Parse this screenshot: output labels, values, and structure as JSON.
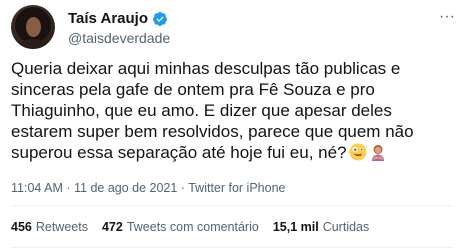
{
  "author": {
    "display_name": "Taís Araujo",
    "handle": "@taisdeverdade",
    "verified_icon": "verified-badge-icon",
    "avatar_icon": "profile-photo"
  },
  "tweet": {
    "text": "Queria deixar aqui minhas desculpas tão publicas e\nsinceras pela gafe de ontem pra Fê Souza e pro\nThiaguinho, que eu amo. E dizer que apesar deles\nestarem super bem resolvidos, parece que quem não\nsuperou essa separação até hoje fui eu, né?",
    "emojis": [
      "zany-face-emoji",
      "woman-gesturing-no-emoji"
    ]
  },
  "meta": {
    "text": "11:04 AM · 11 de ago de 2021 · Twitter for iPhone"
  },
  "stats": {
    "retweets_count": "456",
    "retweets_label": "Retweets",
    "quotes_count": "472",
    "quotes_label": "Tweets com comentário",
    "likes_count": "15,1 mil",
    "likes_label": "Curtidas"
  },
  "colors": {
    "verified": "#1d9bf0",
    "secondary_text": "#536471",
    "primary_text": "#0f1419"
  }
}
